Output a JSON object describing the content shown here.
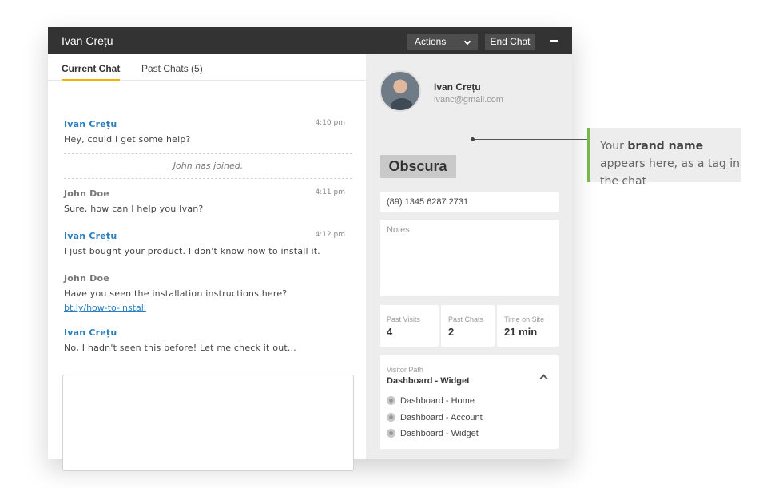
{
  "window": {
    "title": "Ivan Crețu",
    "actions_label": "Actions",
    "end_chat_label": "End Chat"
  },
  "tabs": [
    {
      "label": "Current Chat",
      "active": true
    },
    {
      "label": "Past Chats (5)",
      "active": false
    }
  ],
  "messages": [
    {
      "sender": "Ivan Crețu",
      "role": "customer",
      "time": "4:10 pm",
      "text": "Hey, could I get some help?"
    },
    {
      "sender": "John Doe",
      "role": "agent",
      "time": "4:11 pm",
      "text": "Sure, how can I help you Ivan?"
    },
    {
      "sender": "Ivan Crețu",
      "role": "customer",
      "time": "4:12 pm",
      "text": "I just bought your product. I don't know how to install it."
    },
    {
      "sender": "John Doe",
      "role": "agent",
      "time": "",
      "text": "Have you seen the installation instructions here?",
      "link": "bt.ly/how-to-install"
    },
    {
      "sender": "Ivan Crețu",
      "role": "customer",
      "time": "",
      "text": "No, I hadn't seen this before! Let me check it out..."
    }
  ],
  "system_message": "John has joined.",
  "visitor": {
    "name": "Ivan Crețu",
    "email": "ivanc@gmail.com",
    "brand_tag": "Obscura",
    "phone": "(89) 1345 6287 2731",
    "notes_placeholder": "Notes"
  },
  "stats": [
    {
      "label": "Past Visits",
      "value": "4"
    },
    {
      "label": "Past Chats",
      "value": "2"
    },
    {
      "label": "Time on Site",
      "value": "21 min"
    }
  ],
  "visitor_path": {
    "label": "Visitor Path",
    "current": "Dashboard - Widget",
    "steps": [
      "Dashboard - Home",
      "Dashboard - Account",
      "Dashboard - Widget"
    ]
  },
  "callout": {
    "part1": "Your ",
    "bold": "brand name",
    "part2": " appears here, as a tag in the chat",
    "accent_color": "#7ab648"
  },
  "colors": {
    "titlebar": "#333333",
    "customer_name": "#2a7fbf",
    "active_tab_underline": "#f0b400"
  }
}
